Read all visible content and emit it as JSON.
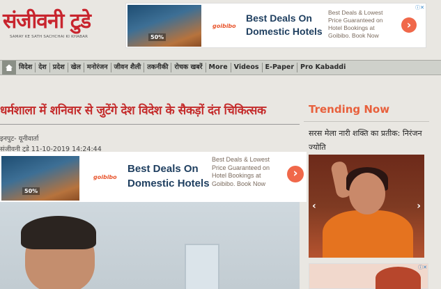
{
  "site": {
    "logo": "संजीवनी टुडे",
    "tagline": "SAMAY KE SATH SACHCHAI KI KHABAR"
  },
  "top_ad": {
    "image_badge": "50%",
    "brand": "goibibo",
    "title_line1": "Best Deals On",
    "title_line2": "Domestic Hotels",
    "desc": [
      "Best Deals & Lowest",
      "Price Guaranteed on",
      "Hotel Bookings at",
      "Goibibo. Book Now"
    ],
    "arrow": "›",
    "close": "ⓘ✕"
  },
  "nav": {
    "items": [
      "विदेश",
      "देश",
      "प्रदेश",
      "खेल",
      "मनोरंजन",
      "जीवन शैली",
      "तकनीकी",
      "रोचक खबरें",
      "More",
      "Videos",
      "E-Paper",
      "Pro Kabaddi"
    ]
  },
  "article": {
    "headline": "धर्मशाला में शनिवार से जुटेंगे देश विदेश के सैकड़ों दंत चिकित्सक",
    "source": "इनपुट- यूनीवार्ता",
    "byline": "संजीवनी टुडे 11-10-2019 14:24:44"
  },
  "mid_ad": {
    "image_badge": "50%",
    "brand": "goibibo",
    "title_line1": "Best Deals On",
    "title_line2": "Domestic Hotels",
    "desc": [
      "Best Deals & Lowest",
      "Price Guaranteed on",
      "Hotel Bookings at",
      "Goibibo. Book Now"
    ],
    "arrow": "›"
  },
  "trending": {
    "heading": "Trending Now",
    "item_title": "सरस मेला नारी शक्ति का प्रतीक: निरंजन ज्योति",
    "prev": "‹",
    "next": "›",
    "ad_close": "ⓘ✕"
  },
  "colors": {
    "brand_red": "#c8252e",
    "trending_orange": "#e8603c",
    "nav_bg": "#cfd1cb",
    "ad_arrow": "#f0684a"
  }
}
